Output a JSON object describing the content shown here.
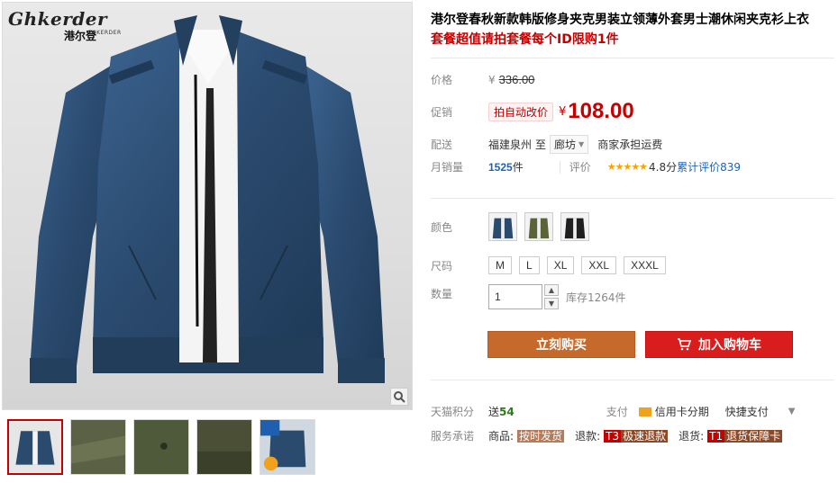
{
  "brand": {
    "name": "Ghkerder",
    "sub": "港尔登",
    "tiny": "GHKERDER"
  },
  "product": {
    "title": "港尔登春秋新款韩版修身夹克男装立领薄外套男士潮休闲夹克衫上衣",
    "subtitle": "套餐超值请拍套餐每个ID限购1件"
  },
  "price": {
    "label": "价格",
    "currency": "¥",
    "original": "336.00",
    "promo_label": "促销",
    "promo_tag": "拍自动改价",
    "current": "108.00"
  },
  "shipping": {
    "label": "配送",
    "from": "福建泉州",
    "to_word": "至",
    "destination": "廊坊",
    "fee": "商家承担运费"
  },
  "sales": {
    "label": "月销量",
    "count": "1525",
    "unit": "件",
    "rating_label": "评价",
    "stars": "★★★★★",
    "score": "4.8分",
    "review_text": "累计评价839"
  },
  "color": {
    "label": "颜色",
    "options": [
      "navy",
      "olive",
      "black"
    ]
  },
  "size": {
    "label": "尺码",
    "options": [
      "M",
      "L",
      "XL",
      "XXL",
      "XXXL"
    ]
  },
  "quantity": {
    "label": "数量",
    "value": "1",
    "up": "▲",
    "down": "▼",
    "stock": "库存1264件"
  },
  "actions": {
    "buy": "立刻购买",
    "cart": "加入购物车"
  },
  "points": {
    "label": "天猫积分",
    "prefix": "送",
    "value": "54",
    "pay_label": "支付",
    "card": "信用卡分期",
    "quick": "快捷支付",
    "caret": "▼"
  },
  "service": {
    "label": "服务承诺",
    "items": [
      {
        "prefix": "商品:",
        "badge": "按时发货"
      },
      {
        "prefix": "退款:",
        "code": "T3",
        "badge": "极速退款"
      },
      {
        "prefix": "退货:",
        "code": "T1",
        "badge": "退货保障卡"
      }
    ]
  },
  "colors": {
    "accent": "#c40000",
    "link": "#1e63b0",
    "buy": "#c66a2c",
    "cart": "#d91d1d",
    "jacket": "#2a4a6e"
  }
}
